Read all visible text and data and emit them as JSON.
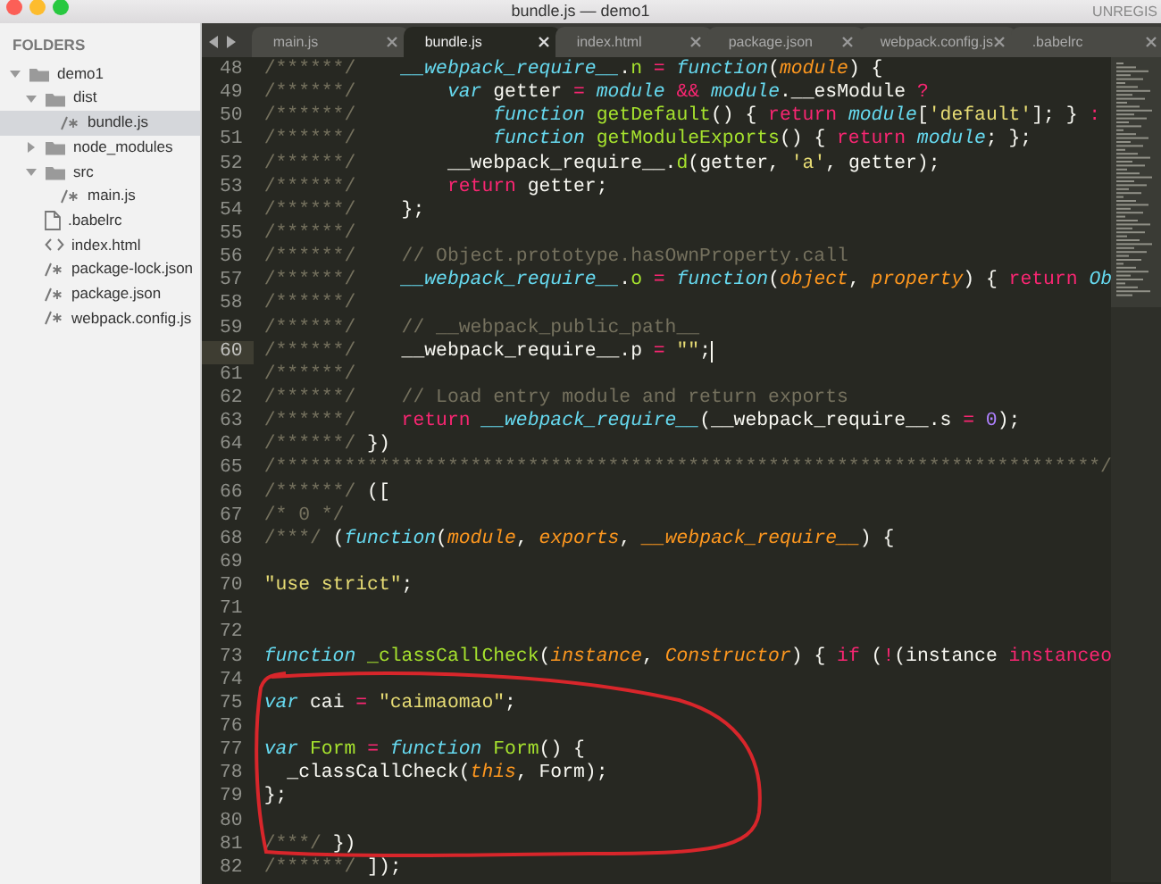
{
  "window": {
    "title": "bundle.js — demo1",
    "badge": "UNREGIS"
  },
  "sidebar": {
    "header": "FOLDERS",
    "items": [
      {
        "label": "demo1",
        "kind": "folder",
        "expanded": true,
        "selected": false,
        "children": [
          {
            "label": "dist",
            "kind": "folder",
            "expanded": true,
            "selected": false,
            "children": [
              {
                "label": "bundle.js",
                "kind": "script",
                "selected": true
              }
            ]
          },
          {
            "label": "node_modules",
            "kind": "folder",
            "expanded": false,
            "selected": false
          },
          {
            "label": "src",
            "kind": "folder",
            "expanded": true,
            "selected": false,
            "children": [
              {
                "label": "main.js",
                "kind": "script",
                "selected": false
              }
            ]
          },
          {
            "label": ".babelrc",
            "kind": "plain",
            "selected": false
          },
          {
            "label": "index.html",
            "kind": "markup",
            "selected": false
          },
          {
            "label": "package-lock.json",
            "kind": "script",
            "selected": false
          },
          {
            "label": "package.json",
            "kind": "script",
            "selected": false
          },
          {
            "label": "webpack.config.js",
            "kind": "script",
            "selected": false
          }
        ]
      }
    ]
  },
  "tabs": [
    {
      "label": "main.js",
      "selected": false
    },
    {
      "label": "bundle.js",
      "selected": true
    },
    {
      "label": "index.html",
      "selected": false
    },
    {
      "label": "package.json",
      "selected": false
    },
    {
      "label": "webpack.config.js",
      "selected": false
    },
    {
      "label": ".babelrc",
      "selected": false
    }
  ],
  "code": {
    "lines": [
      {
        "number": "48",
        "current": false,
        "segments": [
          {
            "kind": "comment",
            "text": "/******/"
          },
          {
            "kind": "storage",
            "text": "    __webpack_require__"
          },
          {
            "kind": "plain",
            "text": "."
          },
          {
            "kind": "entity",
            "text": "n"
          },
          {
            "kind": "keyword",
            "text": " ="
          },
          {
            "kind": "storage",
            "text": " function"
          },
          {
            "kind": "plain",
            "text": "("
          },
          {
            "kind": "param",
            "text": "module"
          },
          {
            "kind": "plain",
            "text": ") {"
          }
        ]
      },
      {
        "number": "49",
        "current": false,
        "segments": [
          {
            "kind": "comment",
            "text": "/******/"
          },
          {
            "kind": "storage",
            "text": "        var"
          },
          {
            "kind": "plain",
            "text": " getter"
          },
          {
            "kind": "keyword",
            "text": " ="
          },
          {
            "kind": "storage",
            "text": " module"
          },
          {
            "kind": "keyword",
            "text": " &&"
          },
          {
            "kind": "storage",
            "text": " module"
          },
          {
            "kind": "plain",
            "text": ".__esModule"
          },
          {
            "kind": "keyword",
            "text": " ?"
          }
        ]
      },
      {
        "number": "50",
        "current": false,
        "segments": [
          {
            "kind": "comment",
            "text": "/******/"
          },
          {
            "kind": "storage",
            "text": "            function"
          },
          {
            "kind": "entity",
            "text": " getDefault"
          },
          {
            "kind": "plain",
            "text": "() {"
          },
          {
            "kind": "keyword",
            "text": " return"
          },
          {
            "kind": "storage",
            "text": " module"
          },
          {
            "kind": "plain",
            "text": "["
          },
          {
            "kind": "string",
            "text": "'default'"
          },
          {
            "kind": "plain",
            "text": "]; }"
          },
          {
            "kind": "keyword",
            "text": " :"
          }
        ]
      },
      {
        "number": "51",
        "current": false,
        "segments": [
          {
            "kind": "comment",
            "text": "/******/"
          },
          {
            "kind": "storage",
            "text": "            function"
          },
          {
            "kind": "entity",
            "text": " getModuleExports"
          },
          {
            "kind": "plain",
            "text": "() {"
          },
          {
            "kind": "keyword",
            "text": " return"
          },
          {
            "kind": "storage",
            "text": " module"
          },
          {
            "kind": "plain",
            "text": "; };"
          }
        ]
      },
      {
        "number": "52",
        "current": false,
        "segments": [
          {
            "kind": "comment",
            "text": "/******/"
          },
          {
            "kind": "plain",
            "text": "        __webpack_require__."
          },
          {
            "kind": "entity",
            "text": "d"
          },
          {
            "kind": "plain",
            "text": "(getter,"
          },
          {
            "kind": "string",
            "text": " 'a'"
          },
          {
            "kind": "plain",
            "text": ", getter);"
          }
        ]
      },
      {
        "number": "53",
        "current": false,
        "segments": [
          {
            "kind": "comment",
            "text": "/******/"
          },
          {
            "kind": "keyword",
            "text": "        return"
          },
          {
            "kind": "plain",
            "text": " getter;"
          }
        ]
      },
      {
        "number": "54",
        "current": false,
        "segments": [
          {
            "kind": "comment",
            "text": "/******/"
          },
          {
            "kind": "plain",
            "text": "    };"
          }
        ]
      },
      {
        "number": "55",
        "current": false,
        "segments": [
          {
            "kind": "comment",
            "text": "/******/"
          }
        ]
      },
      {
        "number": "56",
        "current": false,
        "segments": [
          {
            "kind": "comment",
            "text": "/******/"
          },
          {
            "kind": "comment",
            "text": "    // Object.prototype.hasOwnProperty.call"
          }
        ]
      },
      {
        "number": "57",
        "current": false,
        "segments": [
          {
            "kind": "comment",
            "text": "/******/"
          },
          {
            "kind": "storage",
            "text": "    __webpack_require__"
          },
          {
            "kind": "plain",
            "text": "."
          },
          {
            "kind": "entity",
            "text": "o"
          },
          {
            "kind": "keyword",
            "text": " ="
          },
          {
            "kind": "storage",
            "text": " function"
          },
          {
            "kind": "plain",
            "text": "("
          },
          {
            "kind": "param",
            "text": "object"
          },
          {
            "kind": "plain",
            "text": ","
          },
          {
            "kind": "param",
            "text": " property"
          },
          {
            "kind": "plain",
            "text": ") {"
          },
          {
            "kind": "keyword",
            "text": " return"
          },
          {
            "kind": "storage",
            "text": " Ob"
          }
        ]
      },
      {
        "number": "58",
        "current": false,
        "segments": [
          {
            "kind": "comment",
            "text": "/******/"
          }
        ]
      },
      {
        "number": "59",
        "current": false,
        "segments": [
          {
            "kind": "comment",
            "text": "/******/"
          },
          {
            "kind": "comment",
            "text": "    // __webpack_public_path__"
          }
        ]
      },
      {
        "number": "60",
        "current": true,
        "segments": [
          {
            "kind": "comment",
            "text": "/******/"
          },
          {
            "kind": "plain",
            "text": "    __webpack_require__.p"
          },
          {
            "kind": "keyword",
            "text": " ="
          },
          {
            "kind": "string",
            "text": " \"\""
          },
          {
            "kind": "plain",
            "text": ";"
          }
        ]
      },
      {
        "number": "61",
        "current": false,
        "segments": [
          {
            "kind": "comment",
            "text": "/******/"
          }
        ]
      },
      {
        "number": "62",
        "current": false,
        "segments": [
          {
            "kind": "comment",
            "text": "/******/"
          },
          {
            "kind": "comment",
            "text": "    // Load entry module and return exports"
          }
        ]
      },
      {
        "number": "63",
        "current": false,
        "segments": [
          {
            "kind": "comment",
            "text": "/******/"
          },
          {
            "kind": "keyword",
            "text": "    return"
          },
          {
            "kind": "storage",
            "text": " __webpack_require__"
          },
          {
            "kind": "plain",
            "text": "(__webpack_require__.s"
          },
          {
            "kind": "keyword",
            "text": " ="
          },
          {
            "kind": "number",
            "text": " 0"
          },
          {
            "kind": "plain",
            "text": ");"
          }
        ]
      },
      {
        "number": "64",
        "current": false,
        "segments": [
          {
            "kind": "comment",
            "text": "/******/"
          },
          {
            "kind": "plain",
            "text": " })"
          }
        ]
      },
      {
        "number": "65",
        "current": false,
        "segments": [
          {
            "kind": "comment",
            "text": "/************************************************************************/"
          }
        ]
      },
      {
        "number": "66",
        "current": false,
        "segments": [
          {
            "kind": "comment",
            "text": "/******/"
          },
          {
            "kind": "plain",
            "text": " (["
          }
        ]
      },
      {
        "number": "67",
        "current": false,
        "segments": [
          {
            "kind": "comment",
            "text": "/* 0 */"
          }
        ]
      },
      {
        "number": "68",
        "current": false,
        "segments": [
          {
            "kind": "comment",
            "text": "/***/"
          },
          {
            "kind": "plain",
            "text": " ("
          },
          {
            "kind": "storage",
            "text": "function"
          },
          {
            "kind": "plain",
            "text": "("
          },
          {
            "kind": "param",
            "text": "module"
          },
          {
            "kind": "plain",
            "text": ","
          },
          {
            "kind": "param",
            "text": " exports"
          },
          {
            "kind": "plain",
            "text": ","
          },
          {
            "kind": "param",
            "text": " __webpack_require__"
          },
          {
            "kind": "plain",
            "text": ") {"
          }
        ]
      },
      {
        "number": "69",
        "current": false
      },
      {
        "number": "70",
        "current": false,
        "segments": [
          {
            "kind": "string",
            "text": "\"use strict\""
          },
          {
            "kind": "plain",
            "text": ";"
          }
        ]
      },
      {
        "number": "71",
        "current": false
      },
      {
        "number": "72",
        "current": false
      },
      {
        "number": "73",
        "current": false,
        "segments": [
          {
            "kind": "storage",
            "text": "function"
          },
          {
            "kind": "entity",
            "text": " _classCallCheck"
          },
          {
            "kind": "plain",
            "text": "("
          },
          {
            "kind": "param",
            "text": "instance"
          },
          {
            "kind": "plain",
            "text": ","
          },
          {
            "kind": "param",
            "text": " Constructor"
          },
          {
            "kind": "plain",
            "text": ") {"
          },
          {
            "kind": "keyword",
            "text": " if"
          },
          {
            "kind": "plain",
            "text": " ("
          },
          {
            "kind": "keyword",
            "text": "!"
          },
          {
            "kind": "plain",
            "text": "(instance"
          },
          {
            "kind": "keyword",
            "text": " instanceo"
          }
        ]
      },
      {
        "number": "74",
        "current": false
      },
      {
        "number": "75",
        "current": false,
        "segments": [
          {
            "kind": "storage",
            "text": "var"
          },
          {
            "kind": "plain",
            "text": " cai"
          },
          {
            "kind": "keyword",
            "text": " ="
          },
          {
            "kind": "string",
            "text": " \"caimaomao\""
          },
          {
            "kind": "plain",
            "text": ";"
          }
        ]
      },
      {
        "number": "76",
        "current": false
      },
      {
        "number": "77",
        "current": false,
        "segments": [
          {
            "kind": "storage",
            "text": "var"
          },
          {
            "kind": "entity",
            "text": " Form"
          },
          {
            "kind": "keyword",
            "text": " ="
          },
          {
            "kind": "storage",
            "text": " function"
          },
          {
            "kind": "entity",
            "text": " Form"
          },
          {
            "kind": "plain",
            "text": "() {"
          }
        ]
      },
      {
        "number": "78",
        "current": false,
        "segments": [
          {
            "kind": "plain",
            "text": "  _classCallCheck("
          },
          {
            "kind": "param",
            "text": "this"
          },
          {
            "kind": "plain",
            "text": ", Form);"
          }
        ]
      },
      {
        "number": "79",
        "current": false,
        "segments": [
          {
            "kind": "plain",
            "text": "};"
          }
        ]
      },
      {
        "number": "80",
        "current": false
      },
      {
        "number": "81",
        "current": false,
        "segments": [
          {
            "kind": "comment",
            "text": "/***/"
          },
          {
            "kind": "plain",
            "text": " })"
          }
        ]
      },
      {
        "number": "82",
        "current": false,
        "segments": [
          {
            "kind": "comment",
            "text": "/******/"
          },
          {
            "kind": "plain",
            "text": " ]);"
          }
        ]
      }
    ]
  }
}
